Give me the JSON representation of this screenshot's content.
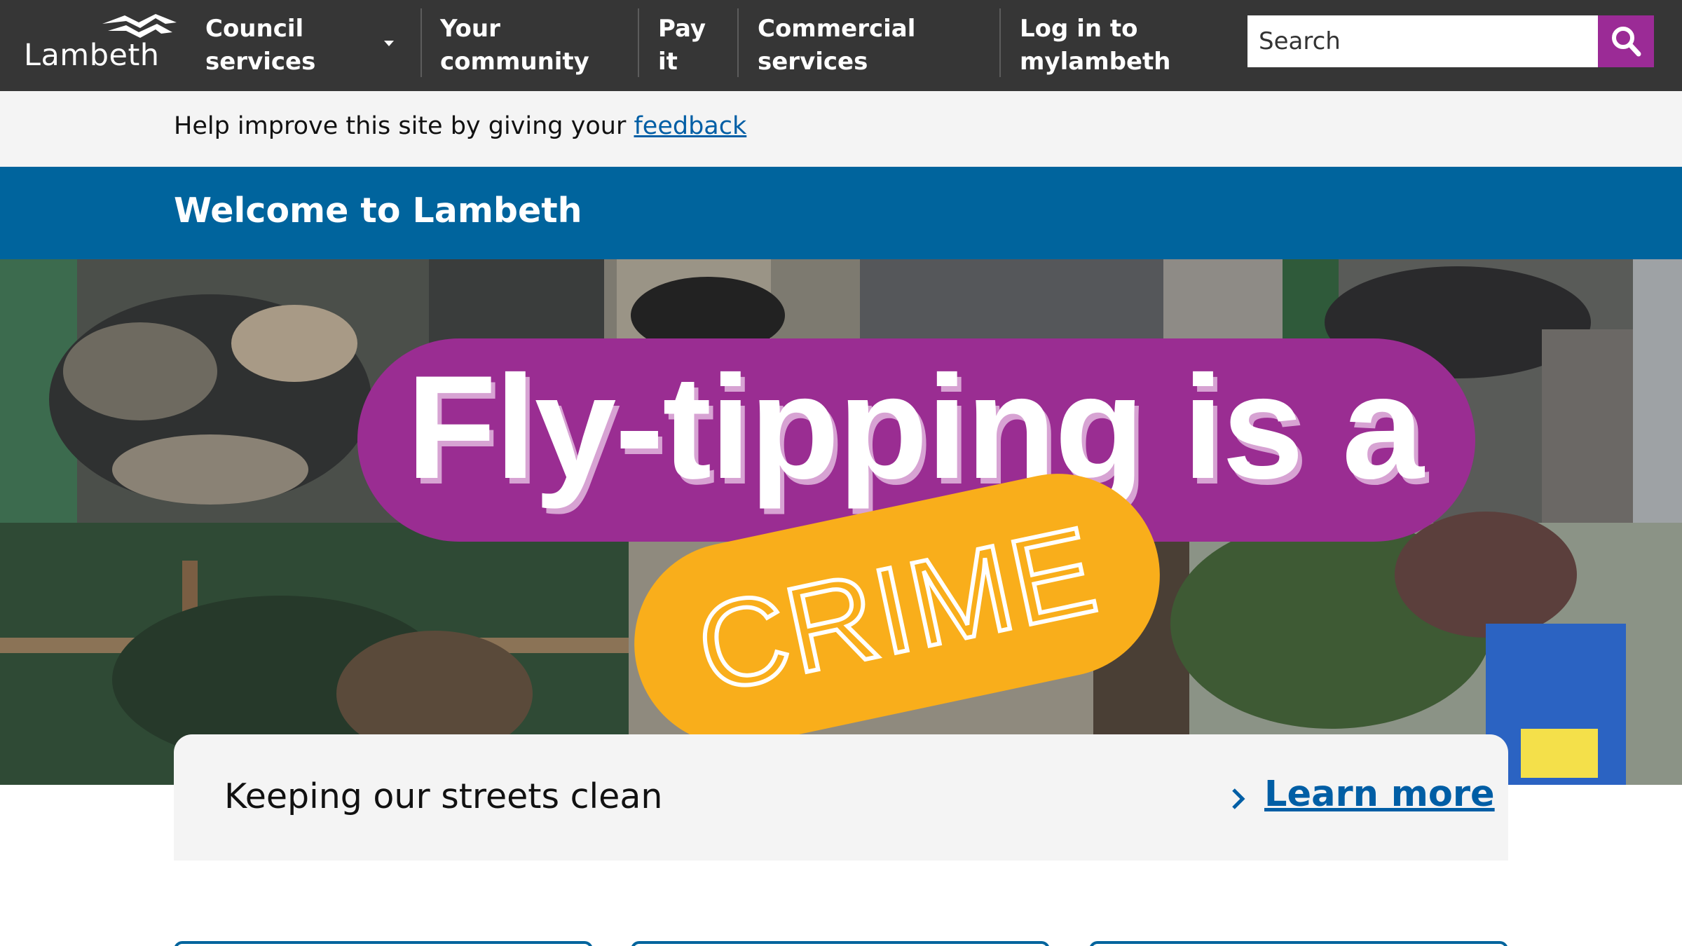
{
  "header": {
    "logo_text": "Lambeth",
    "nav": [
      {
        "line1": "Council",
        "line2": "services"
      },
      {
        "line1": "Your",
        "line2": "community"
      },
      {
        "line1": "Pay",
        "line2": "it"
      },
      {
        "line1": "Commercial",
        "line2": "services"
      },
      {
        "line1": "Log in to",
        "line2": "mylambeth"
      }
    ],
    "search_placeholder": "Search"
  },
  "feedback": {
    "text": "Help improve this site by giving your ",
    "link": "feedback"
  },
  "welcome": {
    "title": "Welcome to Lambeth"
  },
  "hero": {
    "headline": "Fly-tipping is a",
    "stamp": "CRIME"
  },
  "card": {
    "title": "Keeping our streets clean",
    "link": "Learn more"
  },
  "colors": {
    "header_bg": "#363636",
    "welcome_bg": "#00649d",
    "brand_purple": "#9a2d92",
    "crime_yellow": "#f9ae1b",
    "link_blue": "#005ea5"
  },
  "icons": [
    "lambeth-logo-icon",
    "chevron-down-icon",
    "search-icon",
    "chevron-right-icon"
  ]
}
